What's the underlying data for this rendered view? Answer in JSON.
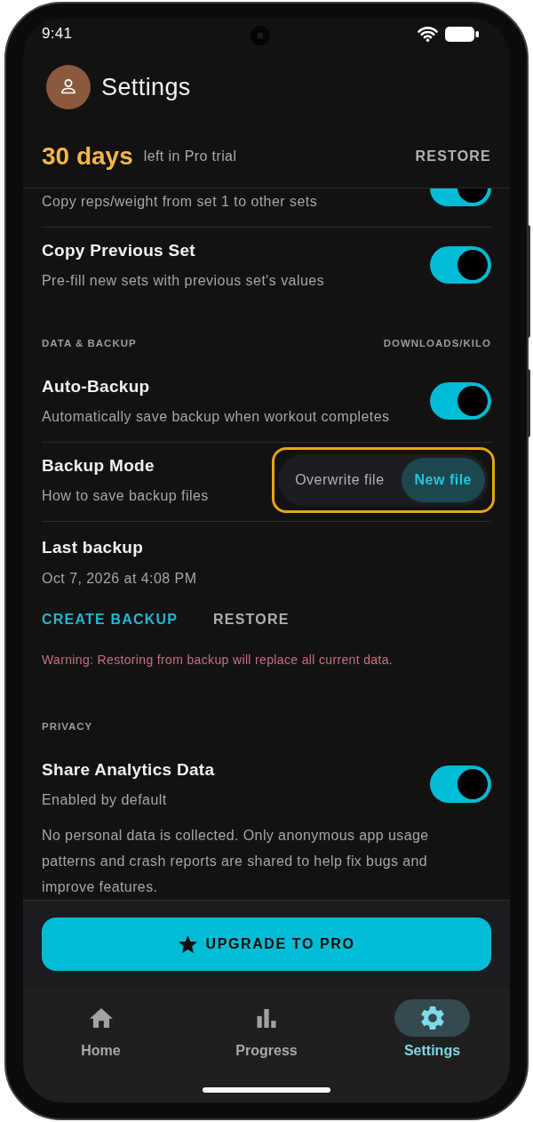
{
  "status_bar": {
    "time": "9:41"
  },
  "header": {
    "title": "Settings"
  },
  "trial_banner": {
    "days": "30 days",
    "text": "left in Pro trial",
    "action": "RESTORE"
  },
  "settings": [
    {
      "kind": "toggle",
      "subtitle": "Copy reps/weight from set 1 to other sets",
      "on": true,
      "cut_off": true
    },
    {
      "kind": "toggle",
      "title": "Copy Previous Set",
      "subtitle": "Pre-fill new sets with previous set's values",
      "on": true,
      "cut_off": false
    },
    {
      "kind": "section",
      "label": "DATA & BACKUP",
      "value": "DOWNLOADS/KILO"
    },
    {
      "kind": "toggle",
      "title": "Auto-Backup",
      "subtitle": "Automatically save backup when workout completes",
      "on": true,
      "cut_off": false
    },
    {
      "kind": "choice",
      "title": "Backup Mode",
      "subtitle": "How to save backup files",
      "focused": true,
      "options": [
        {
          "label": "Overwrite file",
          "selected": false
        },
        {
          "label": "New file",
          "selected": true
        }
      ]
    },
    {
      "kind": "info",
      "title": "Last backup",
      "subtitle": "Oct 7, 2026 at 4:08 PM"
    },
    {
      "kind": "actions",
      "buttons": [
        {
          "label": "CREATE BACKUP",
          "primary": true
        },
        {
          "label": "RESTORE",
          "primary": false
        }
      ]
    },
    {
      "kind": "warning",
      "text": "Warning: Restoring from backup will replace all current data."
    },
    {
      "kind": "section",
      "label": "PRIVACY"
    },
    {
      "kind": "toggle",
      "title": "Share Analytics Data",
      "subtitle": "Enabled by default",
      "on": true,
      "cut_off": false
    },
    {
      "kind": "note",
      "text": "No personal data is collected. Only anonymous app usage patterns and crash reports are shared to help fix bugs and improve features."
    }
  ],
  "upgrade_button": {
    "label": "UPGRADE TO PRO"
  },
  "nav": [
    {
      "label": "Home",
      "selected": false
    },
    {
      "label": "Progress",
      "selected": false
    },
    {
      "label": "Settings",
      "selected": true
    }
  ]
}
